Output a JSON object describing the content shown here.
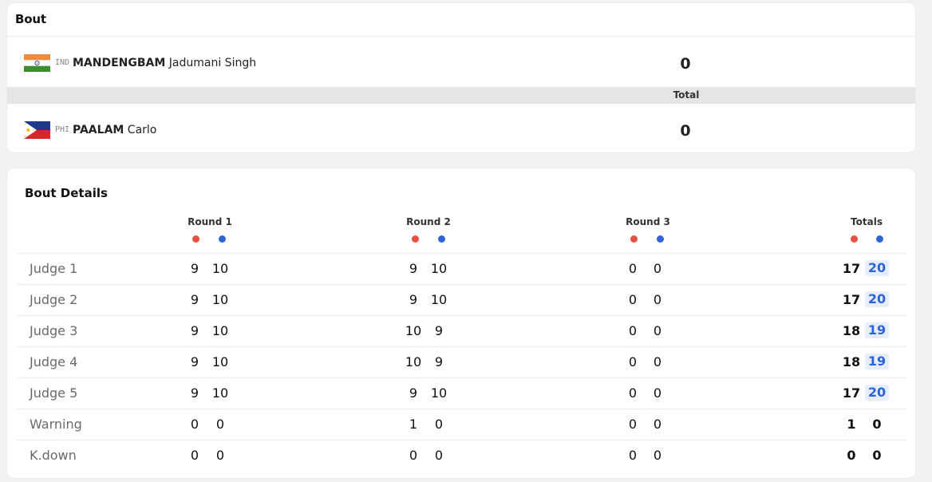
{
  "bout": {
    "title": "Bout",
    "red": {
      "noc": "IND",
      "surname": "MANDENGBAM",
      "given_name": "Jadumani Singh",
      "score": "0",
      "flag": "india-flag"
    },
    "blue": {
      "noc": "PHI",
      "surname": "PAALAM",
      "given_name": "Carlo",
      "score": "0",
      "flag": "philippines-flag"
    },
    "total_label": "Total"
  },
  "details": {
    "title": "Bout Details",
    "columns": [
      "Round 1",
      "Round 2",
      "Round 3",
      "Totals"
    ],
    "colors": {
      "red": "#e8513f",
      "blue": "#2f63d6"
    },
    "rows": [
      {
        "label": "Judge 1",
        "r1": [
          "9",
          "10"
        ],
        "r2": [
          "9",
          "10"
        ],
        "r3": [
          "0",
          "0"
        ],
        "total": [
          "17",
          "20"
        ],
        "winner": "blue"
      },
      {
        "label": "Judge 2",
        "r1": [
          "9",
          "10"
        ],
        "r2": [
          "9",
          "10"
        ],
        "r3": [
          "0",
          "0"
        ],
        "total": [
          "17",
          "20"
        ],
        "winner": "blue"
      },
      {
        "label": "Judge 3",
        "r1": [
          "9",
          "10"
        ],
        "r2": [
          "10",
          "9"
        ],
        "r3": [
          "0",
          "0"
        ],
        "total": [
          "18",
          "19"
        ],
        "winner": "blue"
      },
      {
        "label": "Judge 4",
        "r1": [
          "9",
          "10"
        ],
        "r2": [
          "10",
          "9"
        ],
        "r3": [
          "0",
          "0"
        ],
        "total": [
          "18",
          "19"
        ],
        "winner": "blue"
      },
      {
        "label": "Judge 5",
        "r1": [
          "9",
          "10"
        ],
        "r2": [
          "9",
          "10"
        ],
        "r3": [
          "0",
          "0"
        ],
        "total": [
          "17",
          "20"
        ],
        "winner": "blue"
      },
      {
        "label": "Warning",
        "r1": [
          "0",
          "0"
        ],
        "r2": [
          "1",
          "0"
        ],
        "r3": [
          "0",
          "0"
        ],
        "total": [
          "1",
          "0"
        ],
        "winner": ""
      },
      {
        "label": "K.down",
        "r1": [
          "0",
          "0"
        ],
        "r2": [
          "0",
          "0"
        ],
        "r3": [
          "0",
          "0"
        ],
        "total": [
          "0",
          "0"
        ],
        "winner": ""
      }
    ]
  }
}
